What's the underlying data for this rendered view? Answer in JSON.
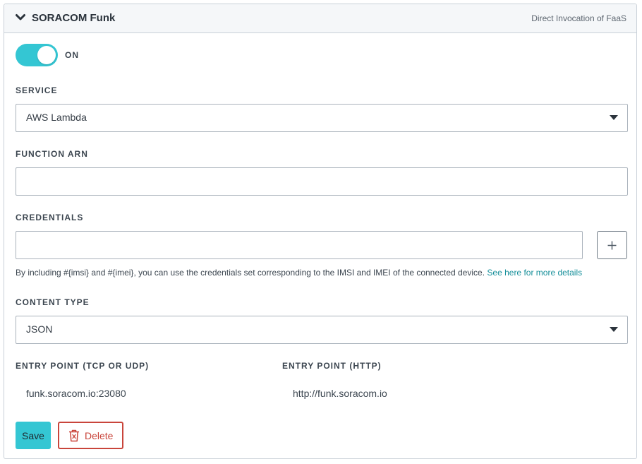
{
  "panel": {
    "title": "SORACOM Funk",
    "subtitle": "Direct Invocation of FaaS"
  },
  "toggle": {
    "state": "ON",
    "on": true
  },
  "service": {
    "label": "SERVICE",
    "value": "AWS Lambda"
  },
  "function_arn": {
    "label": "FUNCTION ARN",
    "value": "",
    "placeholder": ""
  },
  "credentials": {
    "label": "CREDENTIALS",
    "value": "",
    "placeholder": "",
    "help_text": "By including #{imsi} and #{imei}, you can use the credentials set corresponding to the IMSI and IMEI of the connected device.",
    "help_link": "See here for more details"
  },
  "content_type": {
    "label": "CONTENT TYPE",
    "value": "JSON"
  },
  "entry_points": {
    "tcp_udp_label": "ENTRY POINT (TCP OR UDP)",
    "tcp_udp_value": "funk.soracom.io:23080",
    "http_label": "ENTRY POINT (HTTP)",
    "http_value": "http://funk.soracom.io"
  },
  "actions": {
    "save_label": "Save",
    "delete_label": "Delete"
  },
  "colors": {
    "accent": "#34c6d3",
    "danger": "#c9453b",
    "link": "#168f9a"
  },
  "icons": {
    "collapse": "chevron-down-icon",
    "add": "plus-icon",
    "delete": "trash-icon",
    "dropdown": "caret-down-icon"
  }
}
